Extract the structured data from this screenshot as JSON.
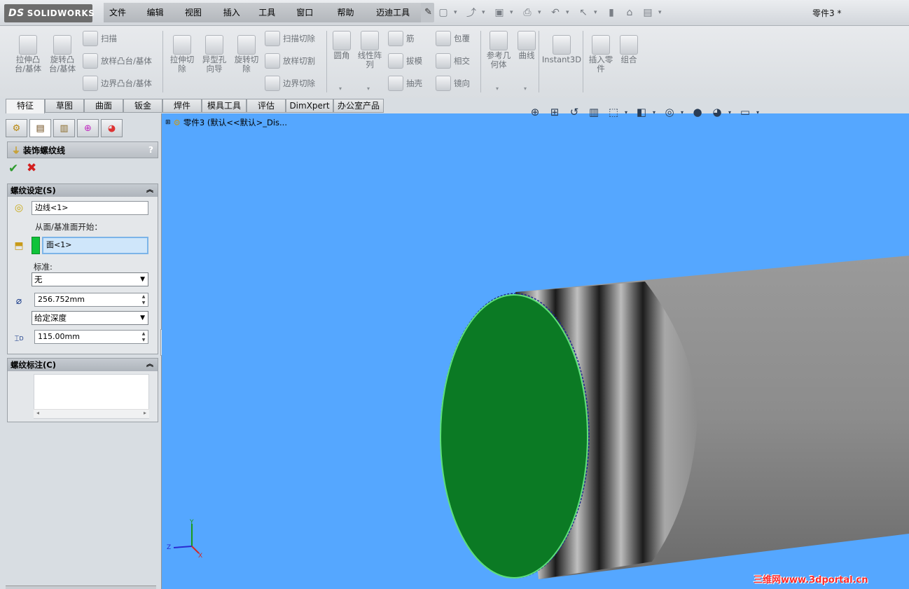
{
  "app": {
    "logo": "SOLIDWORKS",
    "logo_prefix": "DS",
    "document_title": "零件3 *"
  },
  "menu": [
    "文件(F)",
    "编辑(E)",
    "视图(V)",
    "插入(I)",
    "工具(T)",
    "窗口(W)",
    "帮助(H)",
    "迈迪工具集"
  ],
  "quick_access": [
    "new-icon",
    "open-icon",
    "save-icon",
    "print-icon",
    "undo-icon",
    "select-icon",
    "rebuild-icon",
    "options-icon",
    "file-props-icon"
  ],
  "commands": {
    "extrude_boss": "拉伸凸\n台/基体",
    "revolve_boss": "旋转凸\n台/基体",
    "sweep": "扫描",
    "loft": "放样凸台/基体",
    "boundary_boss": "边界凸台/基体",
    "extrude_cut": "拉伸切\n除",
    "hole_wizard": "异型孔\n向导",
    "revolve_cut": "旋转切\n除",
    "swept_cut": "扫描切除",
    "lofted_cut": "放样切割",
    "boundary_cut": "边界切除",
    "fillet": "圆角",
    "linear_pattern": "线性阵\n列",
    "rib": "筋",
    "draft": "拔模",
    "shell": "抽壳",
    "wrap": "包覆",
    "intersect": "相交",
    "mirror": "镜向",
    "ref_geometry": "参考几\n何体",
    "curves": "曲线",
    "instant3d": "Instant3D",
    "insert_part": "插入零\n件",
    "combine": "组合"
  },
  "tabs": [
    "特征",
    "草图",
    "曲面",
    "钣金",
    "焊件",
    "模具工具",
    "评估",
    "DimXpert",
    "办公室产品"
  ],
  "feature_tree": {
    "root": "零件3 (默认<<默认>_Dis..."
  },
  "property_manager": {
    "title": "装饰螺纹线",
    "help": "?",
    "thread_settings": {
      "header": "螺纹设定(S)",
      "edge": "边线<1>",
      "start_from_label": "从面/基准面开始：",
      "face": "面<1>",
      "standard_label": "标准:",
      "standard_value": "无",
      "diameter": "256.752mm",
      "end_condition": "给定深度",
      "depth": "115.00mm",
      "depth_symbol": "D"
    },
    "thread_callout": {
      "header": "螺纹标注(C)"
    }
  },
  "triad": {
    "y": "Y",
    "z": "Z",
    "x": "X"
  },
  "watermark": "三维网www.3dportal.cn",
  "colors": {
    "viewport": "#55a7ff",
    "selected_face": "#0b7a24",
    "cylinder": "#8c8c8c"
  }
}
